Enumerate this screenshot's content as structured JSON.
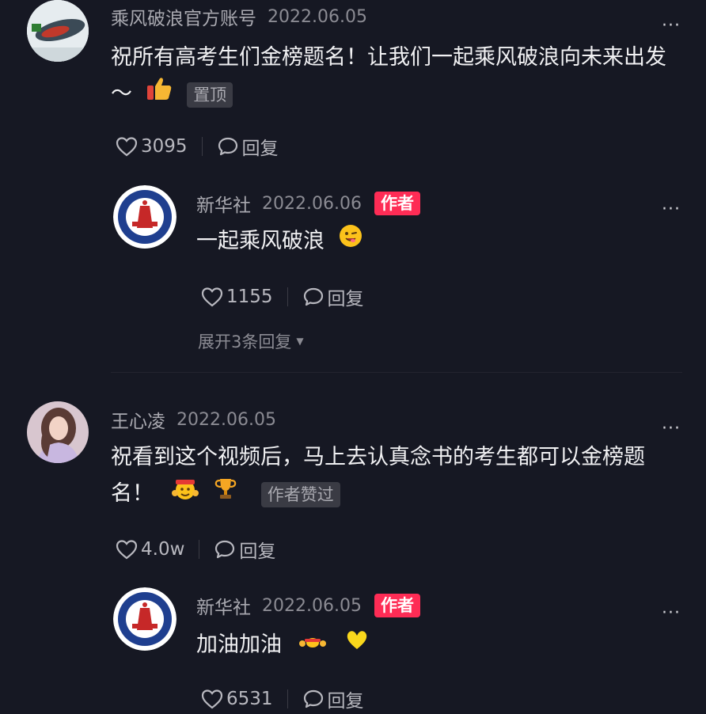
{
  "comments": [
    {
      "name": "乘风破浪官方账号",
      "date": "2022.06.05",
      "text": "祝所有高考生们金榜题名！让我们一起乘风破浪向未来出发～",
      "tag": "置顶",
      "likes": "3095",
      "reply_label": "回复",
      "more": "···"
    },
    {
      "name": "新华社",
      "date": "2022.06.06",
      "badge": "作者",
      "text": "一起乘风破浪",
      "likes": "1155",
      "reply_label": "回复",
      "more": "···",
      "expand_label": "展开3条回复"
    },
    {
      "name": "王心凌",
      "date": "2022.06.05",
      "text": "祝看到这个视频后，马上去认真念书的考生都可以金榜题名！",
      "tag": "作者赞过",
      "likes": "4.0w",
      "reply_label": "回复",
      "more": "···"
    },
    {
      "name": "新华社",
      "date": "2022.06.05",
      "badge": "作者",
      "text": "加油加油",
      "likes": "6531",
      "reply_label": "回复",
      "more": "···"
    }
  ],
  "colors": {
    "background": "#161823",
    "author_badge": "#fe2c55"
  },
  "icons": [
    "heart-icon",
    "reply-bubble-icon",
    "more-dots-icon",
    "thumbs-up-emoji",
    "wink-emoji",
    "trophy-emoji",
    "cheering-emoji",
    "yellow-heart-emoji"
  ]
}
